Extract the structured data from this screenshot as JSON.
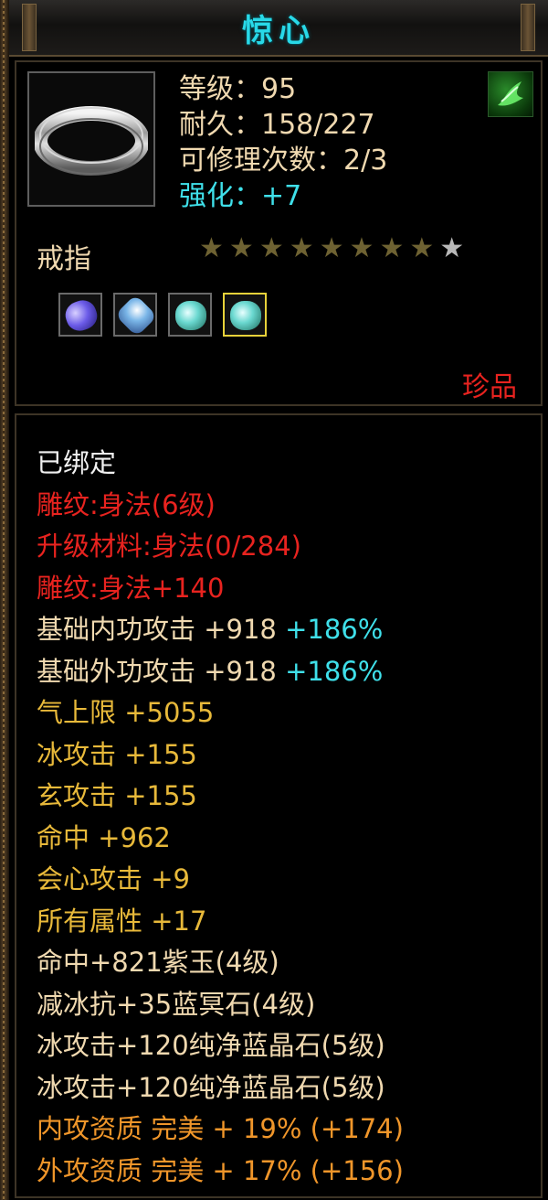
{
  "header": {
    "title": "惊心"
  },
  "item": {
    "level": "等级：95",
    "durability": "耐久：158/227",
    "repair_count": "可修理次数：2/3",
    "enhance": "强化：+7",
    "type": "戒指",
    "quality": "珍品",
    "stars": {
      "total": 9,
      "filled": 8
    },
    "gems": [
      {
        "name": "purple-gem",
        "color": "#6b5be8"
      },
      {
        "name": "blue-crystal-gem",
        "color": "#7ab6e8"
      },
      {
        "name": "blue-crystal-gem",
        "color": "#6ad8d0"
      },
      {
        "name": "blue-crystal-gem",
        "color": "#6ad8d0"
      }
    ]
  },
  "properties": {
    "bound": "已绑定",
    "engrave": "雕纹:身法(6级)",
    "upgrade_material": "升级材料:身法(0/284)",
    "engrave_bonus": "雕纹:身法+140",
    "inner_attack": {
      "label": "基础内功攻击 +918 ",
      "pct": "+186%"
    },
    "outer_attack": {
      "label": "基础外功攻击 +918 ",
      "pct": "+186%"
    },
    "qi_limit": "气上限 +5055",
    "ice_attack": "冰攻击 +155",
    "xuan_attack": "玄攻击 +155",
    "hit": "命中 +962",
    "crit_attack": "会心攻击 +9",
    "all_attributes": "所有属性 +17",
    "gem_line_1": "命中+821紫玉(4级)",
    "gem_line_2": "减冰抗+35蓝冥石(4级)",
    "gem_line_3": "冰攻击+120纯净蓝晶石(5级)",
    "gem_line_4": "冰攻击+120纯净蓝晶石(5级)",
    "inner_quality": "内攻资质 完美 + 19% (+174)",
    "outer_quality": "外攻资质 完美 + 17% (+156)"
  }
}
